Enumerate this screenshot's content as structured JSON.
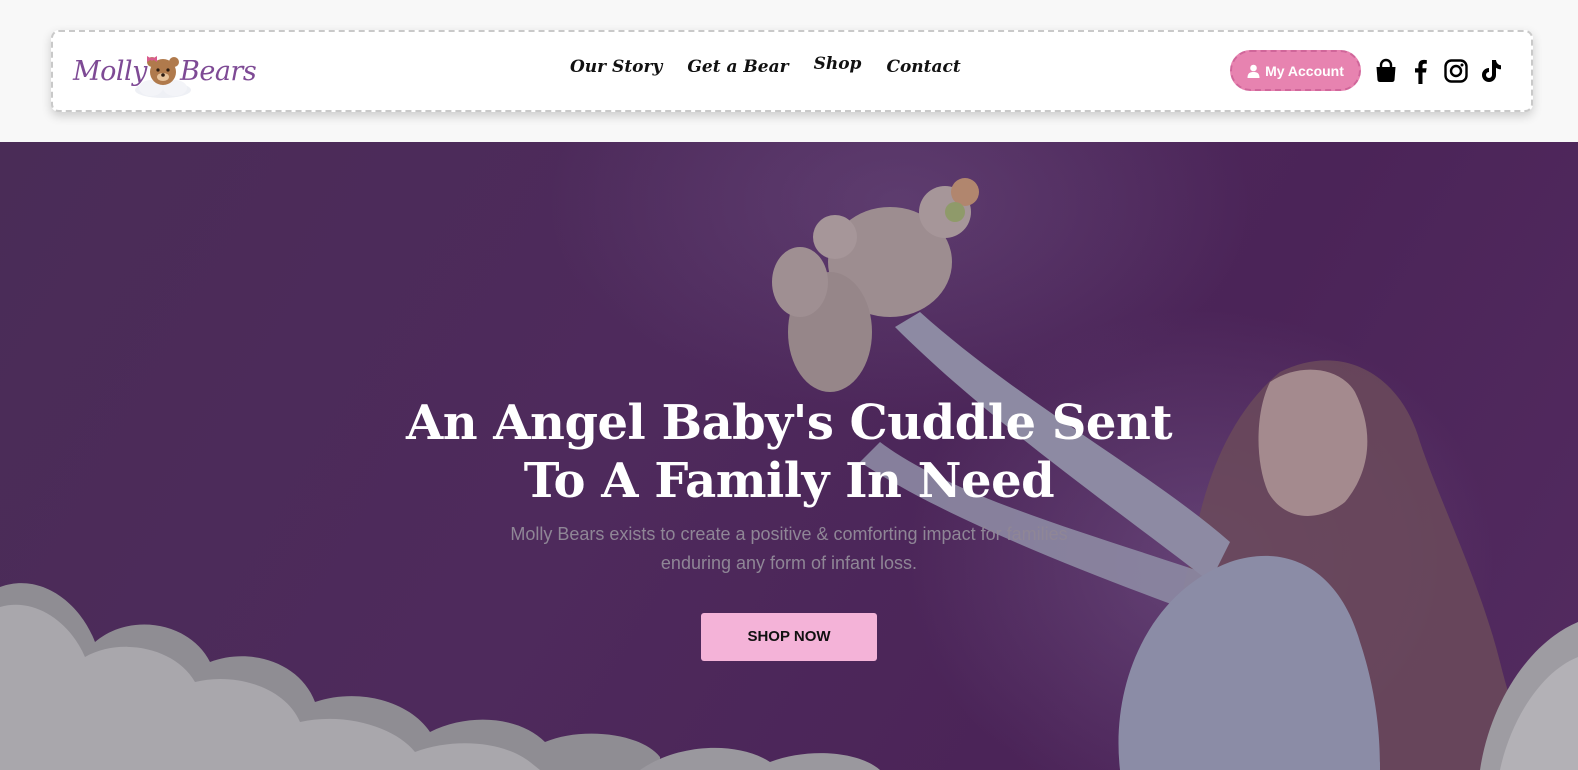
{
  "brand": {
    "logo_left": "Molly",
    "logo_right": "Bears",
    "accent_color": "#7e4a95",
    "pink_color": "#e783b0"
  },
  "nav": {
    "items": [
      {
        "label": "Our Story"
      },
      {
        "label": "Get a Bear"
      },
      {
        "label": "Shop"
      },
      {
        "label": "Contact"
      }
    ]
  },
  "header": {
    "account_label": "My Account",
    "icons": [
      "shopping-bag-icon",
      "facebook-icon",
      "instagram-icon",
      "tiktok-icon"
    ]
  },
  "hero": {
    "title_line1": "An Angel Baby's Cuddle Sent",
    "title_line2": "To A Family In Need",
    "subtitle": "Molly Bears exists to create a positive & comforting impact for families enduring any form of infant loss.",
    "cta_label": "SHOP NOW"
  }
}
